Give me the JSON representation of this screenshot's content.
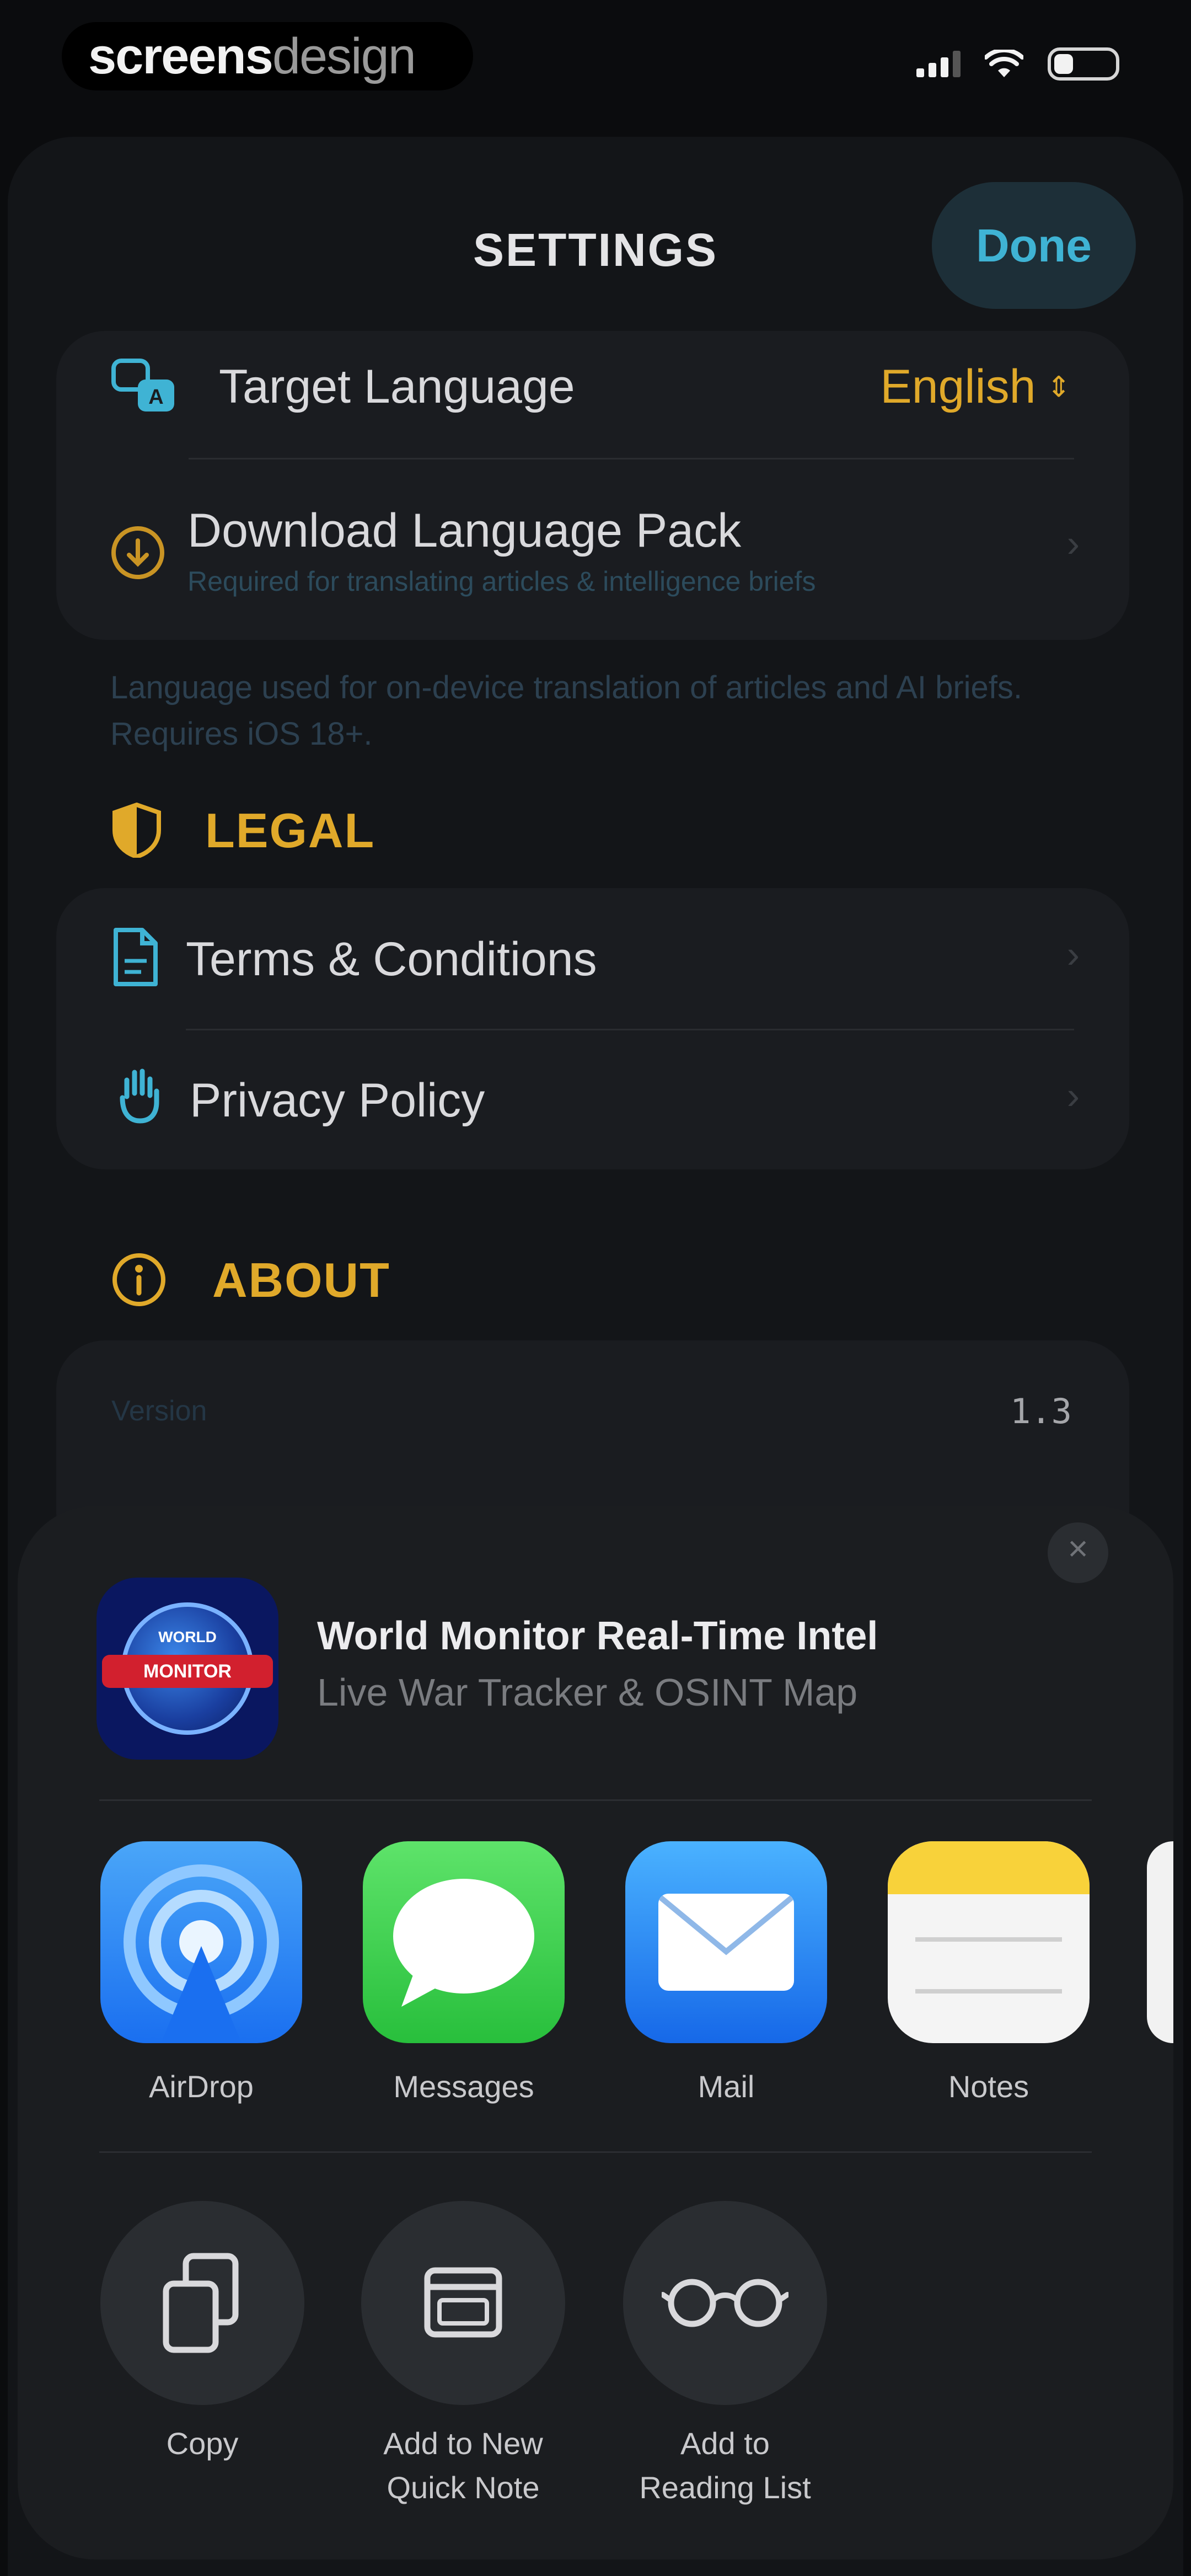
{
  "status_bar": {
    "brand_part1": "screens",
    "brand_part2": "design"
  },
  "nav": {
    "title": "SETTINGS",
    "done_label": "Done"
  },
  "language": {
    "target_label": "Target Language",
    "target_value": "English",
    "download_title": "Download Language Pack",
    "download_subtitle": "Required for translating articles & intelligence briefs",
    "footnote": "Language used for on-device translation of articles and AI briefs. Requires iOS 18+."
  },
  "legal": {
    "section_title": "LEGAL",
    "terms_label": "Terms & Conditions",
    "privacy_label": "Privacy Policy"
  },
  "about": {
    "section_title": "ABOUT",
    "version_label": "Version",
    "version_value": "1.3"
  },
  "share": {
    "app_title": "World Monitor Real-Time Intel",
    "app_subtitle": "Live War Tracker & OSINT Map",
    "icon_text_1": "WORLD",
    "icon_text_2": "MONITOR",
    "apps": [
      {
        "label": "AirDrop",
        "icon": "airdrop-icon"
      },
      {
        "label": "Messages",
        "icon": "messages-icon"
      },
      {
        "label": "Mail",
        "icon": "mail-icon"
      },
      {
        "label": "Notes",
        "icon": "notes-icon"
      }
    ],
    "actions": [
      {
        "label_line1": "Copy",
        "label_line2": "",
        "icon": "copy-icon"
      },
      {
        "label_line1": "Add to New",
        "label_line2": "Quick Note",
        "icon": "quick-note-icon"
      },
      {
        "label_line1": "Add to",
        "label_line2": "Reading List",
        "icon": "reading-list-icon"
      }
    ]
  },
  "colors": {
    "accent_gold": "#e0a92a",
    "accent_teal": "#3fb3d4",
    "background": "#0b0c0e",
    "sheet": "#1b1d20"
  }
}
